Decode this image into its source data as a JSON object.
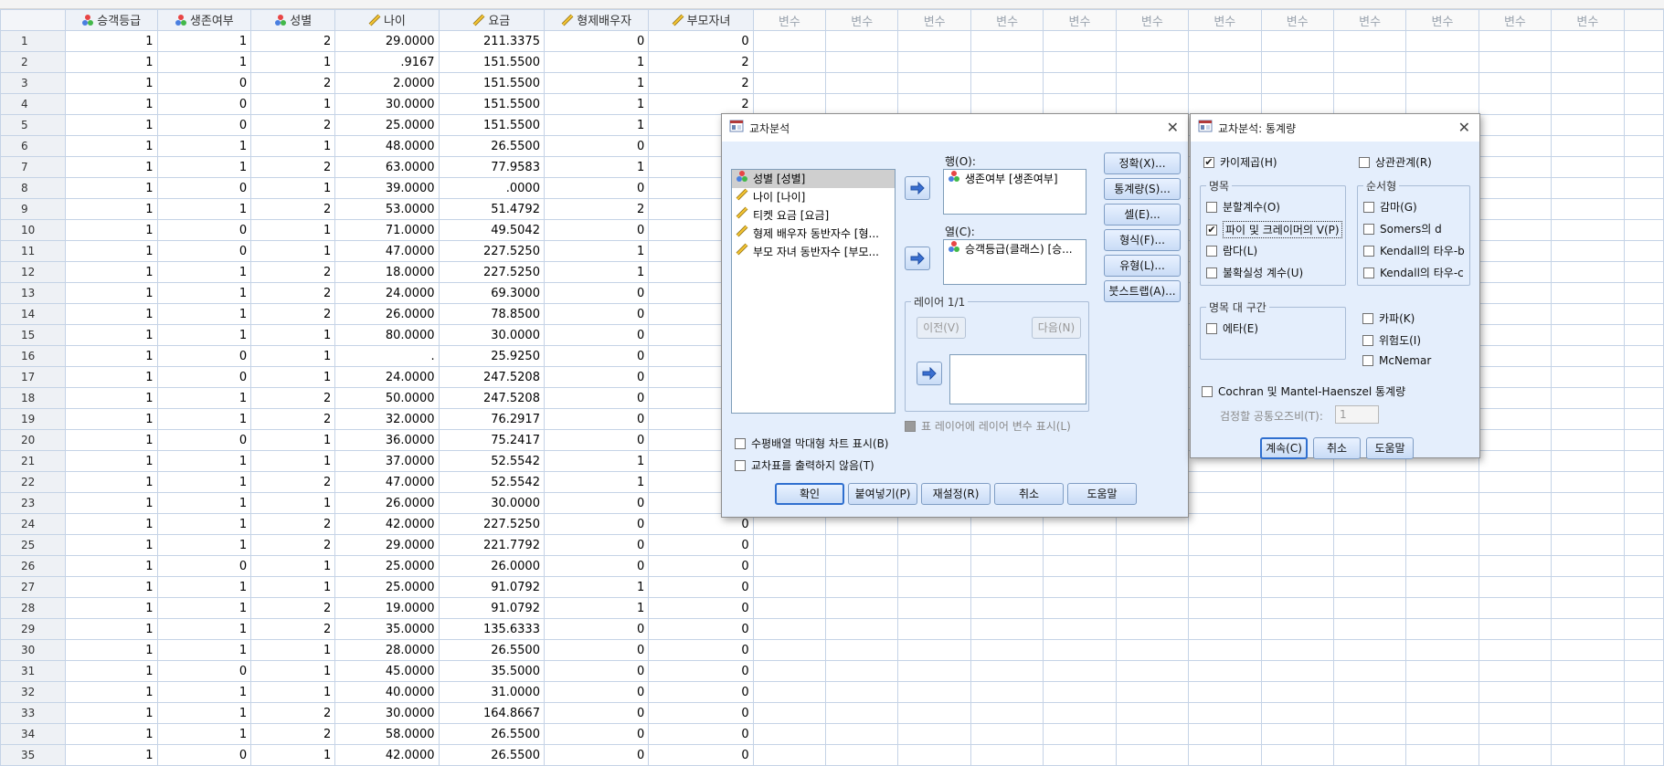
{
  "columns": [
    {
      "name": "승객등급",
      "icon": "nominal-icon"
    },
    {
      "name": "생존여부",
      "icon": "nominal-icon"
    },
    {
      "name": "성별",
      "icon": "nominal-icon"
    },
    {
      "name": "나이",
      "icon": "scale-icon"
    },
    {
      "name": "요금",
      "icon": "scale-icon"
    },
    {
      "name": "형제배우자",
      "icon": "scale-icon"
    },
    {
      "name": "부모자녀",
      "icon": "scale-icon"
    }
  ],
  "empty_column_label": "변수",
  "rows": [
    [
      "1",
      "1",
      "1",
      "2",
      "29.0000",
      "211.3375",
      "0",
      "0"
    ],
    [
      "2",
      "1",
      "1",
      "1",
      ".9167",
      "151.5500",
      "1",
      "2"
    ],
    [
      "3",
      "1",
      "0",
      "2",
      "2.0000",
      "151.5500",
      "1",
      "2"
    ],
    [
      "4",
      "1",
      "0",
      "1",
      "30.0000",
      "151.5500",
      "1",
      "2"
    ],
    [
      "5",
      "1",
      "0",
      "2",
      "25.0000",
      "151.5500",
      "1",
      ""
    ],
    [
      "6",
      "1",
      "1",
      "1",
      "48.0000",
      "26.5500",
      "0",
      ""
    ],
    [
      "7",
      "1",
      "1",
      "2",
      "63.0000",
      "77.9583",
      "1",
      ""
    ],
    [
      "8",
      "1",
      "0",
      "1",
      "39.0000",
      ".0000",
      "0",
      ""
    ],
    [
      "9",
      "1",
      "1",
      "2",
      "53.0000",
      "51.4792",
      "2",
      ""
    ],
    [
      "10",
      "1",
      "0",
      "1",
      "71.0000",
      "49.5042",
      "0",
      ""
    ],
    [
      "11",
      "1",
      "0",
      "1",
      "47.0000",
      "227.5250",
      "1",
      ""
    ],
    [
      "12",
      "1",
      "1",
      "2",
      "18.0000",
      "227.5250",
      "1",
      ""
    ],
    [
      "13",
      "1",
      "1",
      "2",
      "24.0000",
      "69.3000",
      "0",
      ""
    ],
    [
      "14",
      "1",
      "1",
      "2",
      "26.0000",
      "78.8500",
      "0",
      ""
    ],
    [
      "15",
      "1",
      "1",
      "1",
      "80.0000",
      "30.0000",
      "0",
      ""
    ],
    [
      "16",
      "1",
      "0",
      "1",
      ".",
      "25.9250",
      "0",
      ""
    ],
    [
      "17",
      "1",
      "0",
      "1",
      "24.0000",
      "247.5208",
      "0",
      ""
    ],
    [
      "18",
      "1",
      "1",
      "2",
      "50.0000",
      "247.5208",
      "0",
      ""
    ],
    [
      "19",
      "1",
      "1",
      "2",
      "32.0000",
      "76.2917",
      "0",
      ""
    ],
    [
      "20",
      "1",
      "0",
      "1",
      "36.0000",
      "75.2417",
      "0",
      ""
    ],
    [
      "21",
      "1",
      "1",
      "1",
      "37.0000",
      "52.5542",
      "1",
      ""
    ],
    [
      "22",
      "1",
      "1",
      "2",
      "47.0000",
      "52.5542",
      "1",
      ""
    ],
    [
      "23",
      "1",
      "1",
      "1",
      "26.0000",
      "30.0000",
      "0",
      ""
    ],
    [
      "24",
      "1",
      "1",
      "2",
      "42.0000",
      "227.5250",
      "0",
      "0"
    ],
    [
      "25",
      "1",
      "1",
      "2",
      "29.0000",
      "221.7792",
      "0",
      "0"
    ],
    [
      "26",
      "1",
      "0",
      "1",
      "25.0000",
      "26.0000",
      "0",
      "0"
    ],
    [
      "27",
      "1",
      "1",
      "1",
      "25.0000",
      "91.0792",
      "1",
      "0"
    ],
    [
      "28",
      "1",
      "1",
      "2",
      "19.0000",
      "91.0792",
      "1",
      "0"
    ],
    [
      "29",
      "1",
      "1",
      "2",
      "35.0000",
      "135.6333",
      "0",
      "0"
    ],
    [
      "30",
      "1",
      "1",
      "1",
      "28.0000",
      "26.5500",
      "0",
      "0"
    ],
    [
      "31",
      "1",
      "0",
      "1",
      "45.0000",
      "35.5000",
      "0",
      "0"
    ],
    [
      "32",
      "1",
      "1",
      "1",
      "40.0000",
      "31.0000",
      "0",
      "0"
    ],
    [
      "33",
      "1",
      "1",
      "2",
      "30.0000",
      "164.8667",
      "0",
      "0"
    ],
    [
      "34",
      "1",
      "1",
      "2",
      "58.0000",
      "26.5500",
      "0",
      "0"
    ],
    [
      "35",
      "1",
      "0",
      "1",
      "42.0000",
      "26.5500",
      "0",
      "0"
    ]
  ],
  "crosstabs": {
    "title": "교차분석",
    "close": "✕",
    "variables": [
      {
        "label": "성별 [성별]",
        "icon": "nominal-icon",
        "selected": true
      },
      {
        "label": "나이 [나이]",
        "icon": "scale-icon"
      },
      {
        "label": "티켓 요금 [요금]",
        "icon": "scale-icon"
      },
      {
        "label": "형제 배우자 동반자수 [형...",
        "icon": "scale-icon"
      },
      {
        "label": "부모 자녀 동반자수 [부모...",
        "icon": "scale-icon"
      }
    ],
    "rows_label": "행(O):",
    "rows_value": "생존여부 [생존여부]",
    "cols_label": "열(C):",
    "cols_value": "승객등급(클래스) [승...",
    "layer_label": "레이어 1/1",
    "prev": "이전(V)",
    "next": "다음(N)",
    "layer_check": "표 레이어에 레이어 변수 표시(L)",
    "bar_chart": "수평배열 막대형 차트 표시(B)",
    "suppress": "교차표를 출력하지 않음(T)",
    "side_buttons": [
      "정확(X)...",
      "통계량(S)...",
      "셀(E)...",
      "형식(F)...",
      "유형(L)...",
      "붓스트랩(A)..."
    ],
    "bottom_buttons": [
      "확인",
      "붙여넣기(P)",
      "재설정(R)",
      "취소",
      "도움말"
    ]
  },
  "stats": {
    "title": "교차분석: 통계량",
    "close": "✕",
    "chi_square": "카이제곱(H)",
    "correlations": "상관관계(R)",
    "nominal_group": "명목",
    "contingency": "분할계수(O)",
    "phi": "파이 및 크레이머의 V(P)",
    "lambda": "람다(L)",
    "uncertainty": "불확실성 계수(U)",
    "ordinal_group": "순서형",
    "gamma": "감마(G)",
    "somers": "Somers의 d",
    "kendall_b": "Kendall의 타우-b",
    "kendall_c": "Kendall의 타우-c",
    "interval_group": "명목 대 구간",
    "eta": "에타(E)",
    "kappa": "카파(K)",
    "risk": "위험도(I)",
    "mcnemar": "McNemar",
    "cochran": "Cochran 및 Mantel-Haenszel 통계량",
    "odds_label": "검정할 공통오즈비(T):",
    "odds_value": "1",
    "continue": "계속(C)",
    "cancel": "취소",
    "help": "도움말"
  }
}
